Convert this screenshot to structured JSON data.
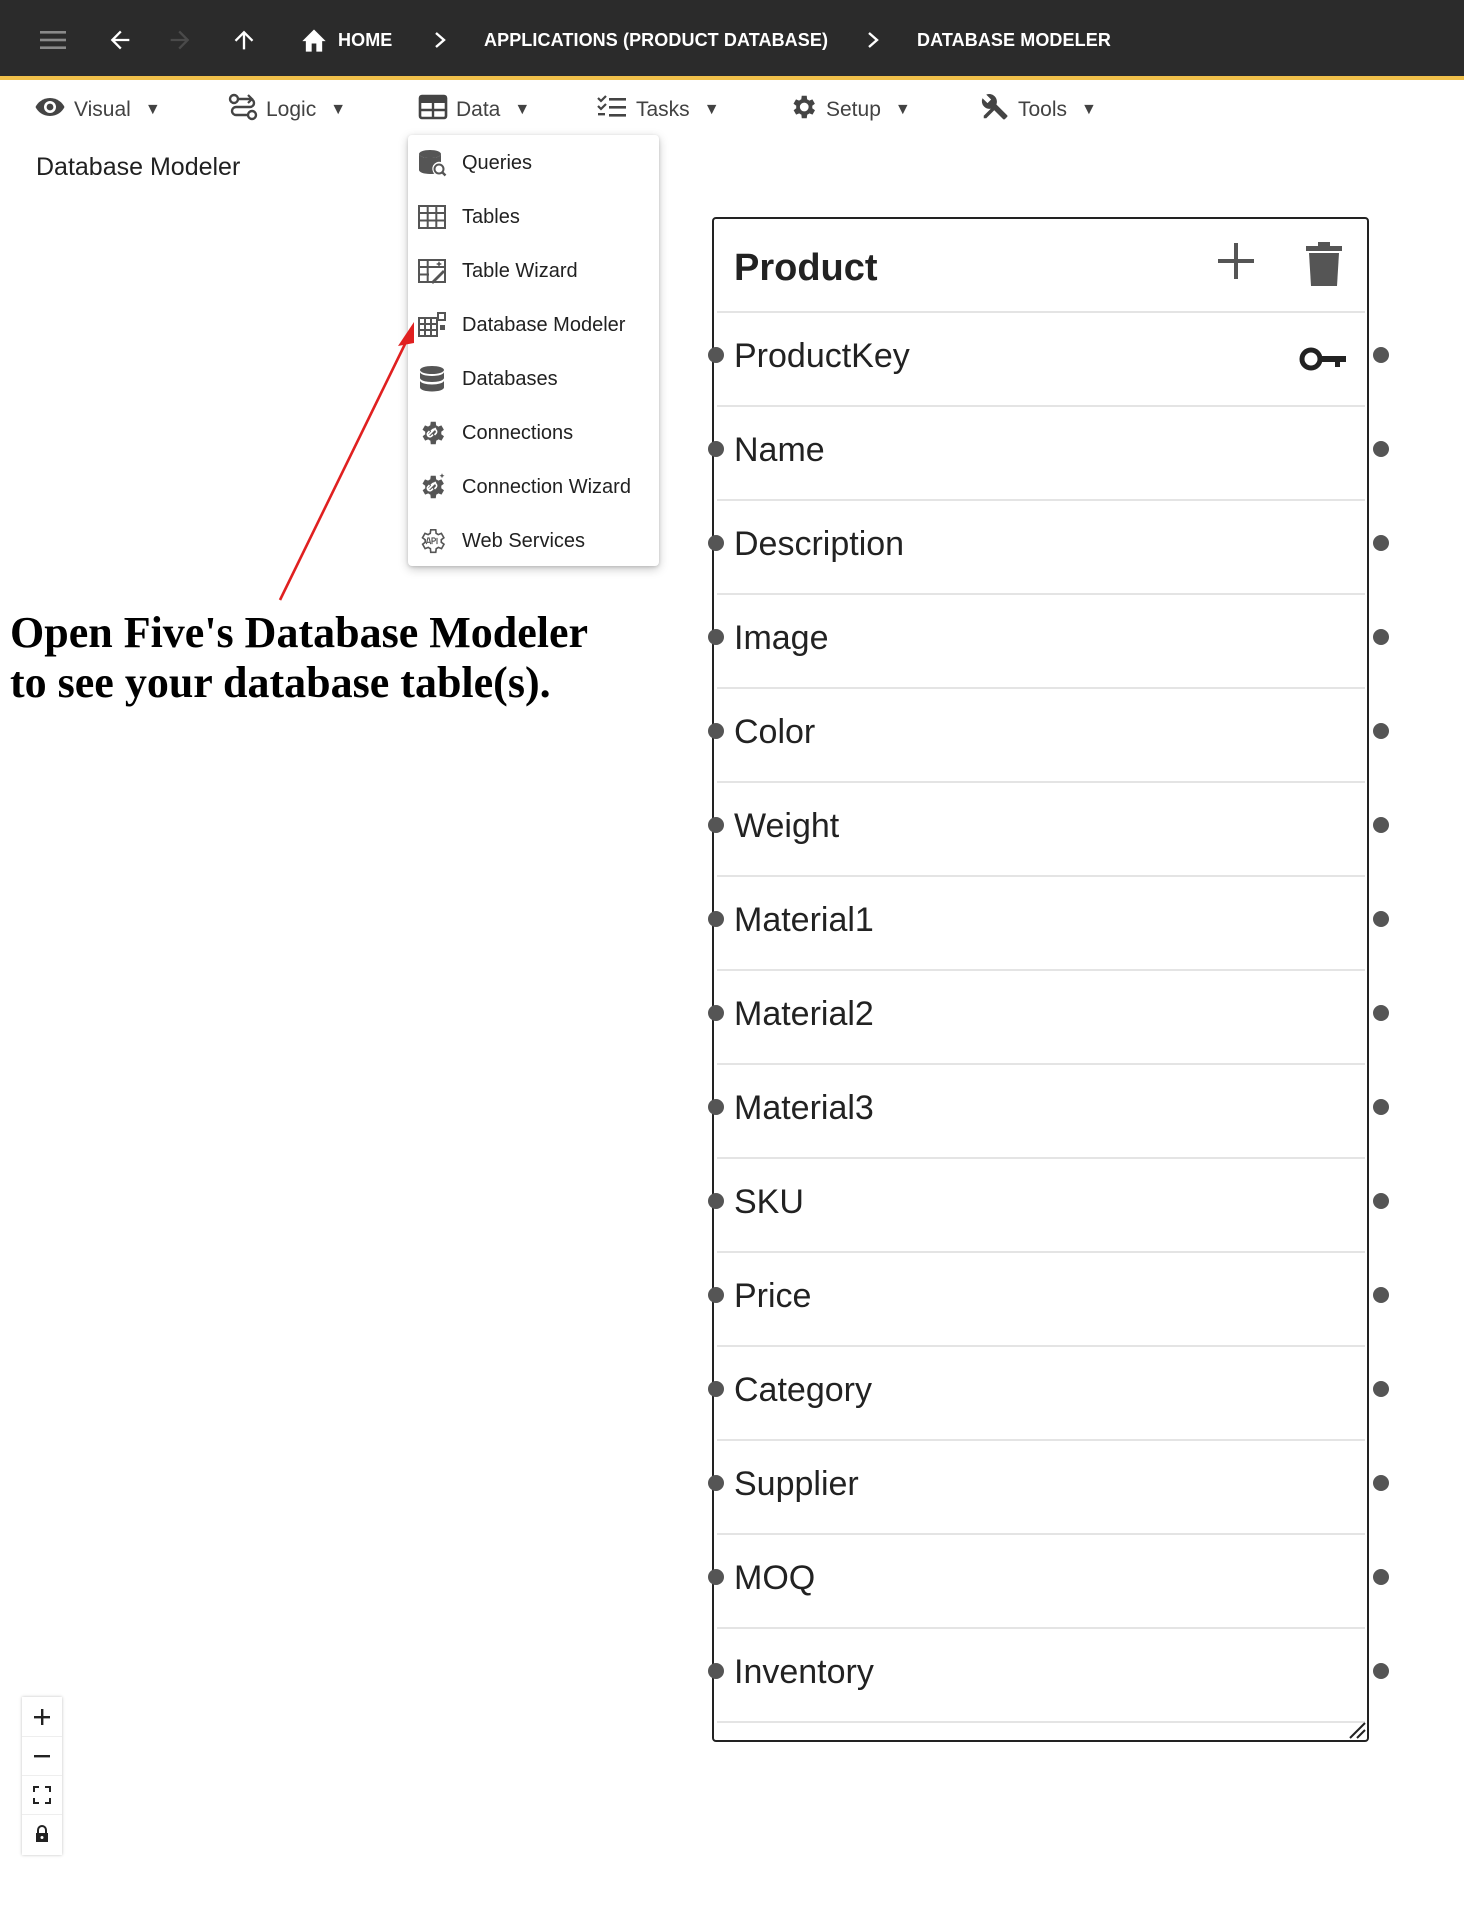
{
  "topbar": {
    "crumbs": [
      "HOME",
      "APPLICATIONS (PRODUCT DATABASE)",
      "DATABASE MODELER"
    ],
    "separator": ">",
    "accent_color": "#f0c04a",
    "background_color": "#2b2b2b"
  },
  "menus": [
    {
      "label": "Visual",
      "icon": "eye-icon"
    },
    {
      "label": "Logic",
      "icon": "logic-flow-icon"
    },
    {
      "label": "Data",
      "icon": "table-grid-icon"
    },
    {
      "label": "Tasks",
      "icon": "checklist-icon"
    },
    {
      "label": "Setup",
      "icon": "gear-icon"
    },
    {
      "label": "Tools",
      "icon": "wrench-screwdriver-icon"
    }
  ],
  "caret": "▼",
  "page_title": "Database Modeler",
  "dropdown": {
    "items": [
      {
        "label": "Queries",
        "icon": "query-database-icon"
      },
      {
        "label": "Tables",
        "icon": "table-icon"
      },
      {
        "label": "Table Wizard",
        "icon": "table-wizard-icon"
      },
      {
        "label": "Database Modeler",
        "icon": "database-modeler-icon"
      },
      {
        "label": "Databases",
        "icon": "databases-icon"
      },
      {
        "label": "Connections",
        "icon": "connections-icon"
      },
      {
        "label": "Connection Wizard",
        "icon": "connection-wizard-icon"
      },
      {
        "label": "Web Services",
        "icon": "api-gear-icon"
      }
    ]
  },
  "annotation": {
    "line1": "Open Five's Database Modeler",
    "line2": "to see your database table(s).",
    "arrow_color": "#e02020"
  },
  "entity": {
    "name": "Product",
    "fields": [
      "ProductKey",
      "Name",
      "Description",
      "Image",
      "Color",
      "Weight",
      "Material1",
      "Material2",
      "Material3",
      "SKU",
      "Price",
      "Category",
      "Supplier",
      "MOQ",
      "Inventory"
    ],
    "primary_key": "ProductKey"
  },
  "zoom_controls": [
    "zoom-in",
    "zoom-out",
    "fit-view",
    "lock"
  ]
}
